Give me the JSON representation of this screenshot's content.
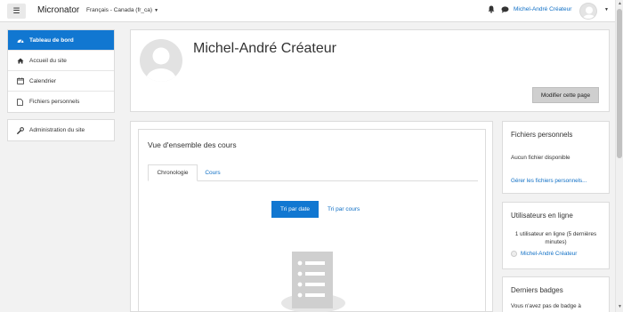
{
  "navbar": {
    "brand": "Micronator",
    "language": "Français - Canada (fr_ca)",
    "user_name": "Michel-André Créateur"
  },
  "leftnav": {
    "items": [
      {
        "label": "Tableau de bord",
        "icon": "dashboard-icon",
        "active": true
      },
      {
        "label": "Accueil du site",
        "icon": "home-icon"
      },
      {
        "label": "Calendrier",
        "icon": "calendar-icon"
      },
      {
        "label": "Fichiers personnels",
        "icon": "file-icon"
      }
    ],
    "admin": {
      "label": "Administration du site",
      "icon": "wrench-icon"
    }
  },
  "header": {
    "name": "Michel-André Créateur",
    "edit_button": "Modifier cette page"
  },
  "overview": {
    "title": "Vue d'ensemble des cours",
    "tabs": [
      "Chronologie",
      "Cours"
    ],
    "sort_date": "Tri par date",
    "sort_course": "Tri par cours"
  },
  "blocks": {
    "files": {
      "title": "Fichiers personnels",
      "empty": "Aucun fichier disponible",
      "manage_link": "Gérer les fichiers personnels..."
    },
    "online": {
      "title": "Utilisateurs en ligne",
      "info": "1 utilisateur en ligne (5 dernières minutes)",
      "user": "Michel-André Créateur"
    },
    "badges": {
      "title": "Derniers badges",
      "text": "Vous n'avez pas de badge à"
    }
  },
  "colors": {
    "accent": "#1177d1",
    "link": "#0f6fc5",
    "background": "#f2f2f2"
  }
}
